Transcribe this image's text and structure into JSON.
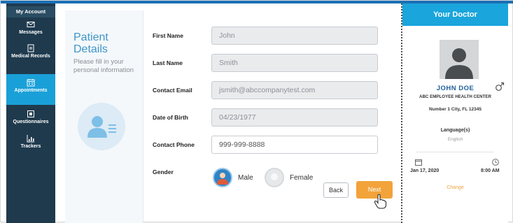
{
  "sidebar": {
    "my_account": "My Account",
    "items": [
      {
        "label": "Messages",
        "icon": "envelope-icon"
      },
      {
        "label": "Medical Records",
        "icon": "document-icon"
      },
      {
        "label": "Appointments",
        "icon": "calendar-icon"
      },
      {
        "label": "Questionnaires",
        "icon": "checklist-icon"
      },
      {
        "label": "Trackers",
        "icon": "chart-icon"
      }
    ],
    "active": "Appointments",
    "colors": {
      "bg": "#1f3a4d",
      "active": "#1aa0d8"
    }
  },
  "info": {
    "title": "Patient Details",
    "subtitle": "Please fill in your personal information"
  },
  "form": {
    "first_name": {
      "label": "First Name",
      "value": "John"
    },
    "last_name": {
      "label": "Last Name",
      "value": "Smith"
    },
    "email": {
      "label": "Contact Email",
      "value": "jsmith@abccompanytest.com"
    },
    "dob": {
      "label": "Date of Birth",
      "value": "04/23/1977"
    },
    "phone": {
      "label": "Contact Phone",
      "value": "999-999-8888"
    },
    "gender": {
      "label": "Gender",
      "options": [
        "Male",
        "Female"
      ],
      "selected": "Male"
    },
    "back_label": "Back",
    "next_label": "Next"
  },
  "doctor": {
    "heading": "Your Doctor",
    "name": "JOHN DOE",
    "center": "ABC EMPLOYEE HEALTH CENTER",
    "address": "Number 1 City, FL 12345",
    "language_label": "Language(s)",
    "language": "English",
    "date": "Jan 17, 2020",
    "time": "8:00 AM",
    "change_label": "Change",
    "colors": {
      "header": "#1aa5dc",
      "accent": "#f2a33a"
    }
  }
}
